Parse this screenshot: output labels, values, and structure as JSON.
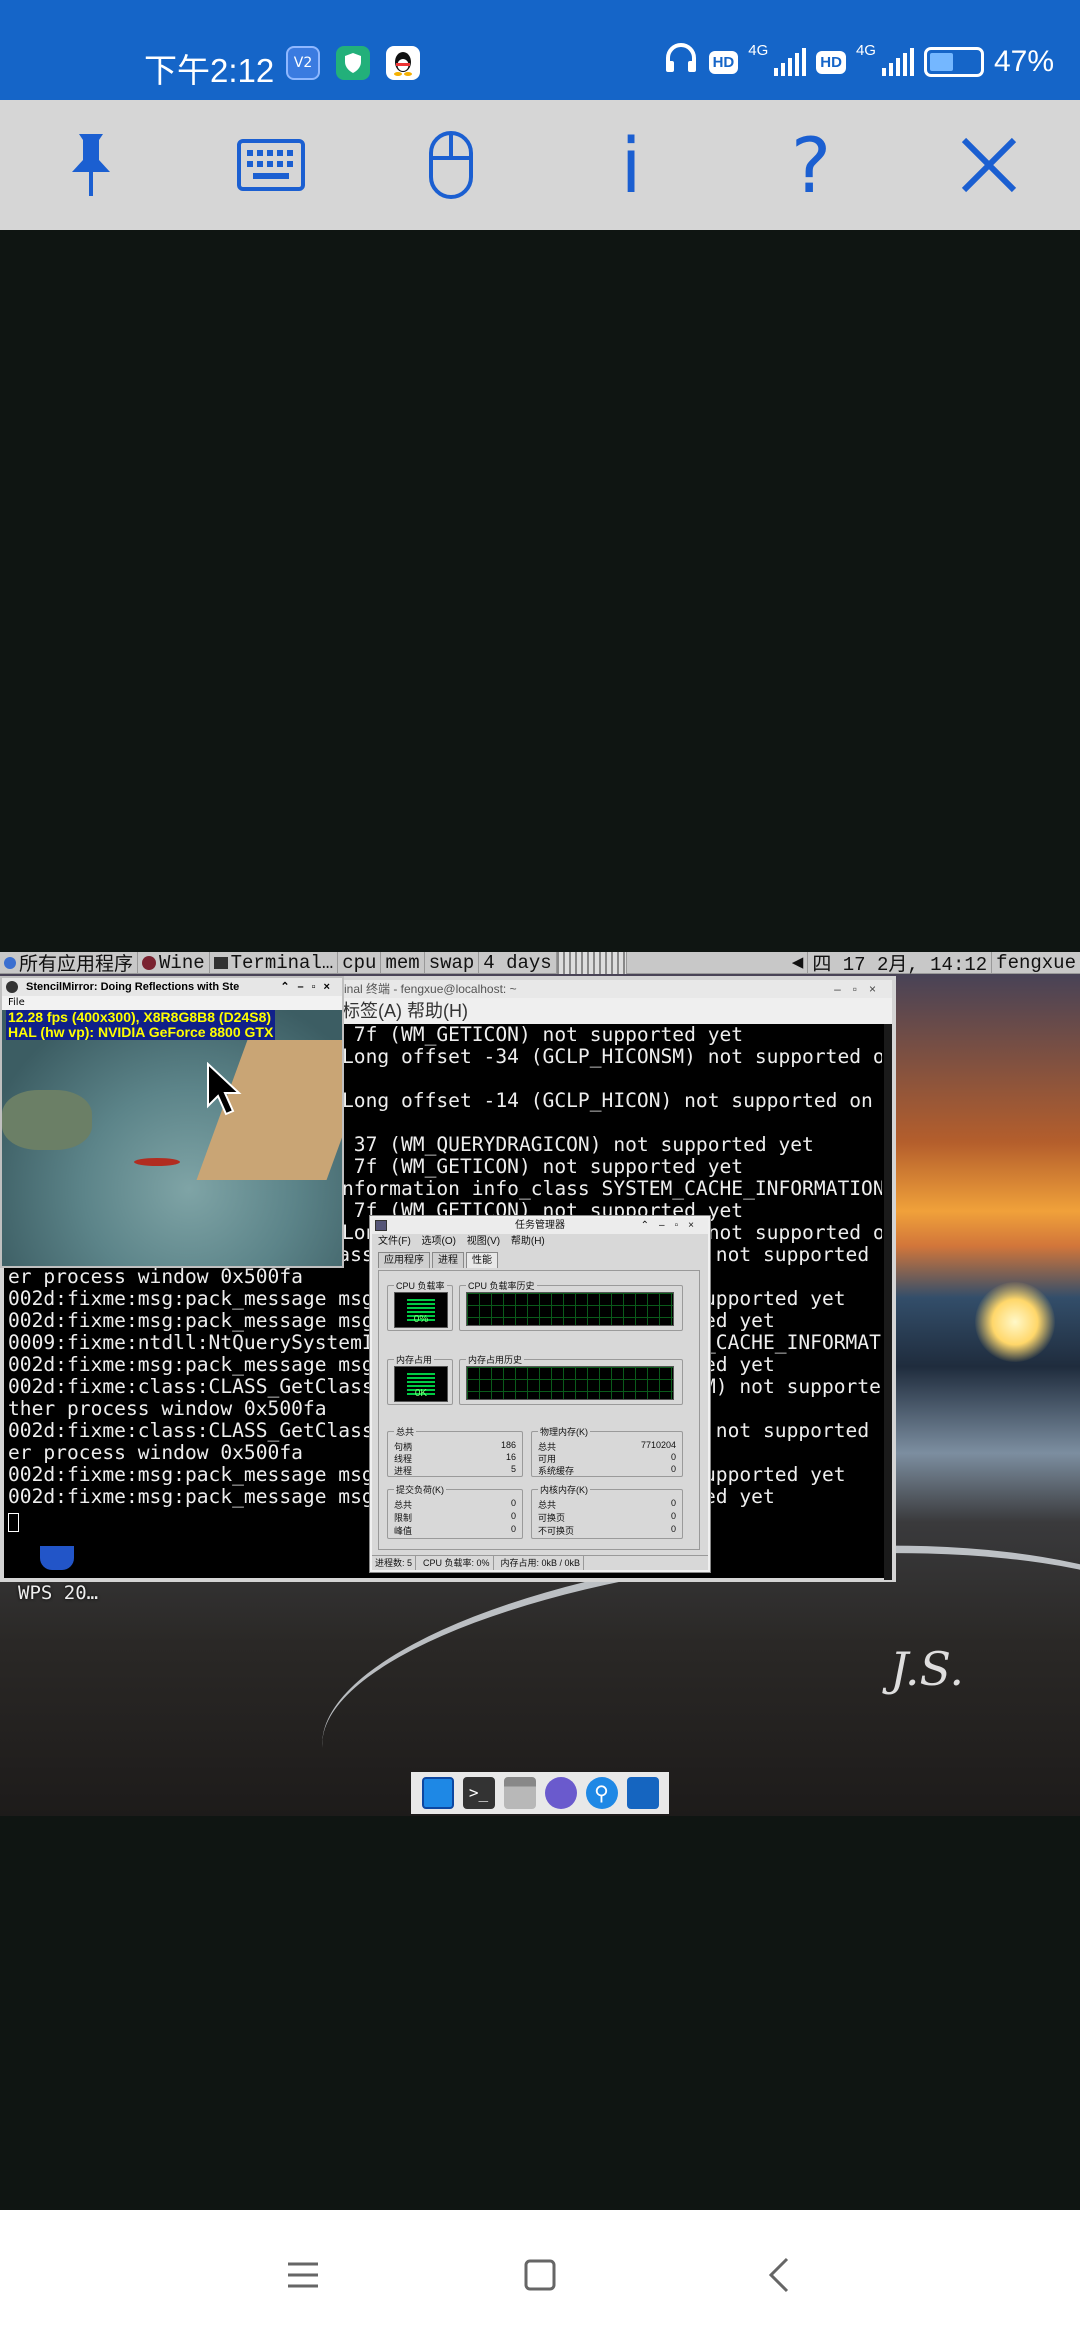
{
  "status_bar": {
    "time": "下午2:12",
    "app_icons": [
      "V2",
      "shield",
      "QQ"
    ],
    "hd1": "HD",
    "net1": "4G",
    "hd2": "HD",
    "net2": "4G",
    "battery_percent": "47%",
    "battery_level": 0.47
  },
  "toolbar": {
    "buttons": [
      "pin-icon",
      "keyboard-icon",
      "mouse-icon",
      "info-icon",
      "help-icon",
      "close-icon"
    ],
    "info_label": "i",
    "help_label": "?"
  },
  "desktop": {
    "panel": {
      "apps_menu": "所有应用程序",
      "task1": "Wine",
      "task2": "Terminal…",
      "cpu_label": "cpu",
      "mem_label": "mem",
      "swap_label": "swap",
      "uptime": "4 days",
      "clock": "四 17 2月, 14:12",
      "user": "fengxue"
    },
    "terminal": {
      "title": "inal 终端 - fengxue@localhost: ~",
      "menu": "标签(A)  帮助(H)",
      "lines": [
        " 7f (WM_GETICON) not supported yet",
        "Long offset -34 (GCLP_HICONSM) not supported on o",
        "",
        "Long offset -14 (GCLP_HICON) not supported on oth",
        "",
        " 37 (WM_QUERYDRAGICON) not supported yet",
        " 7f (WM_GETICON) not supported yet",
        "nformation info_class SYSTEM_CACHE_INFORMATION",
        " 7f (WM_GETICON) not supported yet",
        "Long offset -34 (GCLP_HICONSM) not supported on o",
        "002d:fixme:class:CLASS_GetClassLong offset -14 (GCLP_HICON) not supported on oth",
        "er process window 0x500fa",
        "002d:fixme:msg:pack_message msg 37 (WM_QUERYDRAGICON) not supported yet",
        "002d:fixme:msg:pack_message msg 7f (WM_GETICON) not supported yet",
        "0009:fixme:ntdll:NtQuerySystemInformation info_class SYSTEM_CACHE_INFORMATION",
        "002d:fixme:msg:pack_message msg 7f (WM_GETICON) not supported yet",
        "002d:fixme:class:CLASS_GetClassLong offset -34 (GCLP_HICONSM) not supported on o",
        "ther process window 0x500fa",
        "002d:fixme:class:CLASS_GetClassLong offset -14 (GCLP_HICON) not supported on oth",
        "er process window 0x500fa",
        "002d:fixme:msg:pack_message msg 37 (WM_QUERYDRAGICON) not supported yet",
        "002d:fixme:msg:pack_message msg 7f (WM_GETICON) not supported yet"
      ]
    },
    "stencil": {
      "title": "StencilMirror: Doing Reflections with Ste",
      "menu": "File",
      "fps": "12.28 fps (400x300), X8R8G8B8 (D24S8)",
      "hal": "HAL (hw vp): NVIDIA GeForce 8800 GTX"
    },
    "taskmgr": {
      "title": "任务管理器",
      "menu": "文件(F) 选项(O) 视图(V) 帮助(H)",
      "tabs": [
        "应用程序",
        "进程",
        "性能"
      ],
      "cpu_usage_label": "CPU 负载率",
      "cpu_history_label": "CPU 负载率历史",
      "cpu_value": "0%",
      "mem_usage_label": "内存占用",
      "mem_history_label": "内存占用历史",
      "mem_value": "0K",
      "totals_label": "总共",
      "totals": [
        [
          "句柄",
          "186"
        ],
        [
          "线程",
          "16"
        ],
        [
          "进程",
          "5"
        ]
      ],
      "physical_label": "物理内存(K)",
      "physical": [
        [
          "总共",
          "7710204"
        ],
        [
          "可用",
          "0"
        ],
        [
          "系统缓存",
          "0"
        ]
      ],
      "commit_label": "提交负荷(K)",
      "commit": [
        [
          "总共",
          "0"
        ],
        [
          "限制",
          "0"
        ],
        [
          "峰值",
          "0"
        ]
      ],
      "kernel_label": "内核内存(K)",
      "kernel": [
        [
          "总共",
          "0"
        ],
        [
          "可换页",
          "0"
        ],
        [
          "不可换页",
          "0"
        ]
      ],
      "status_processes": "进程数: 5",
      "status_cpu": "CPU 负载率:   0%",
      "status_mem": "内存占用: 0kB / 0kB"
    },
    "wps_label": "WPS 20…",
    "dock_items": [
      "desktop-icon",
      "terminal-icon",
      "archive-icon",
      "browser-icon",
      "search-icon",
      "files-icon"
    ]
  },
  "nav_bar": {
    "buttons": [
      "menu-icon",
      "home-icon",
      "back-icon"
    ]
  }
}
